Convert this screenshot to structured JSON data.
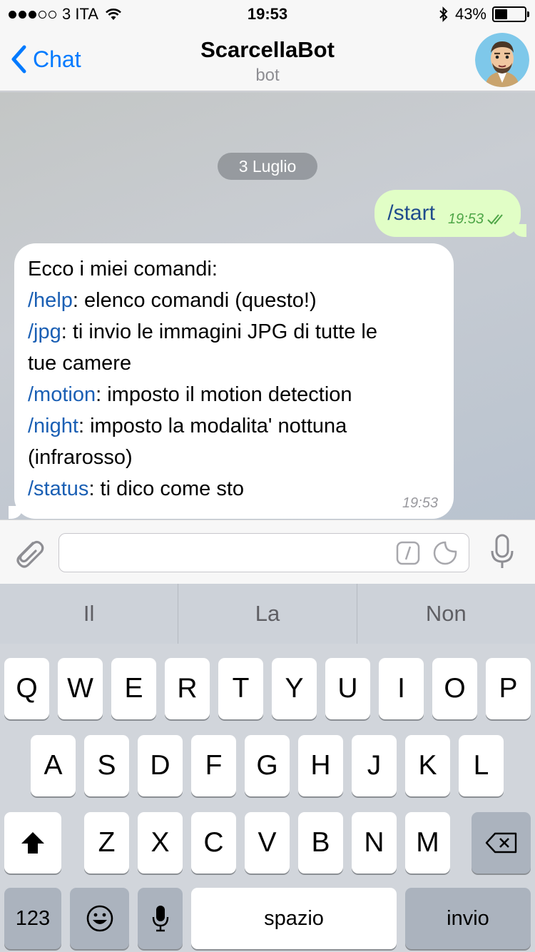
{
  "status_bar": {
    "carrier": "3 ITA",
    "time": "19:53",
    "battery_percent": "43%",
    "battery_level": 0.43
  },
  "nav": {
    "back_label": "Chat",
    "title": "ScarcellaBot",
    "subtitle": "bot"
  },
  "chat": {
    "date_label": "3 Luglio",
    "outgoing": {
      "text": "/start",
      "time": "19:53"
    },
    "incoming": {
      "intro": "Ecco i miei comandi:",
      "lines": [
        {
          "cmd": "/help",
          "text": ": elenco comandi (questo!)"
        },
        {
          "cmd": "/jpg",
          "text": ": ti invio le immagini JPG di tutte le"
        },
        {
          "cmd": "",
          "text": "tue camere"
        },
        {
          "cmd": "/motion",
          "text": ": imposto il motion detection"
        },
        {
          "cmd": "/night",
          "text": ": imposto la modalita' nottuna"
        },
        {
          "cmd": "",
          "text": "(infrarosso)"
        },
        {
          "cmd": "/status",
          "text": ": ti dico come sto"
        }
      ],
      "time": "19:53"
    }
  },
  "input": {
    "value": ""
  },
  "suggestions": [
    "Il",
    "La",
    "Non"
  ],
  "keyboard": {
    "row1": [
      "Q",
      "W",
      "E",
      "R",
      "T",
      "Y",
      "U",
      "I",
      "O",
      "P"
    ],
    "row2": [
      "A",
      "S",
      "D",
      "F",
      "G",
      "H",
      "J",
      "K",
      "L"
    ],
    "row3": [
      "Z",
      "X",
      "C",
      "V",
      "B",
      "N",
      "M"
    ],
    "numbers_label": "123",
    "space_label": "spazio",
    "return_label": "invio"
  }
}
